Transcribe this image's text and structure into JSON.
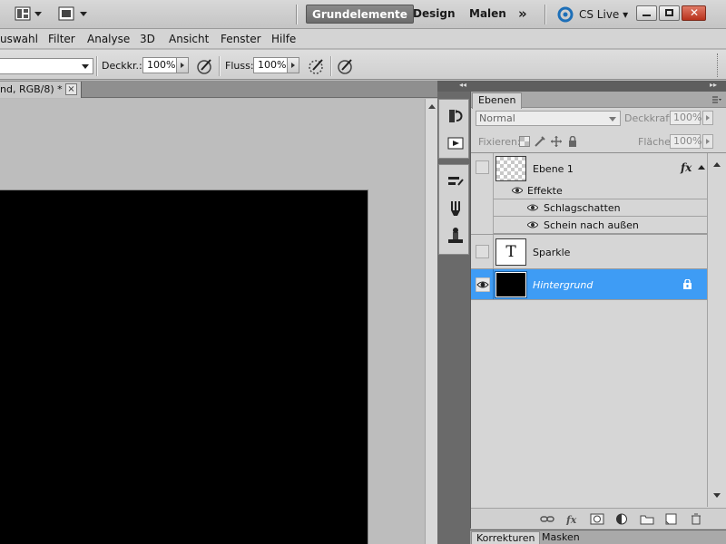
{
  "workspace": {
    "buttons": [
      "Grundelemente",
      "Design",
      "Malen"
    ],
    "active": "Grundelemente",
    "overflow": "»",
    "cs_live": "CS Live"
  },
  "menu": {
    "items": [
      "uswahl",
      "Filter",
      "Analyse",
      "3D",
      "Ansicht",
      "Fenster",
      "Hilfe"
    ]
  },
  "options": {
    "opacity_label": "Deckkr.:",
    "opacity_value": "100%",
    "flow_label": "Fluss:",
    "flow_value": "100%"
  },
  "document": {
    "tab_title": "nd, RGB/8) *",
    "close_symbol": "×"
  },
  "layers_panel": {
    "tab": "Ebenen",
    "blend_mode": "Normal",
    "opacity_label": "Deckkraft:",
    "opacity_value": "100%",
    "lock_label": "Fixieren:",
    "fill_label": "Fläche:",
    "fill_value": "100%",
    "layers": [
      {
        "name": "Ebene 1",
        "fx": "fx",
        "visible": false
      },
      {
        "name": "Sparkle",
        "thumb_text": "T",
        "visible": false
      },
      {
        "name": "Hintergrund",
        "visible": true,
        "selected": true
      }
    ],
    "effects_label": "Effekte",
    "effects": [
      "Schlagschatten",
      "Schein nach außen"
    ]
  },
  "bottom_tabs": [
    "Korrekturen",
    "Masken"
  ],
  "colors": {
    "selection": "#3e9cf5",
    "canvas": "#000000",
    "panel_bg": "#d6d6d6"
  }
}
